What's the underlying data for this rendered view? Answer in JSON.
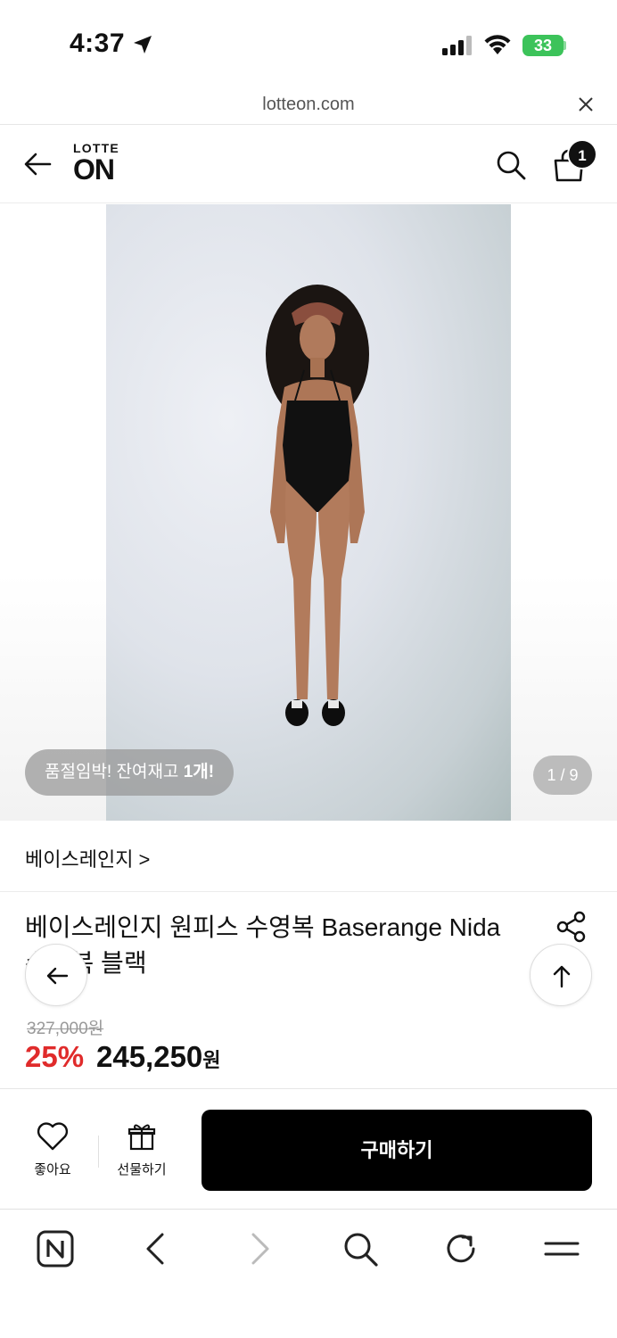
{
  "status_bar": {
    "time": "4:37",
    "battery": "33"
  },
  "url_bar": {
    "url": "lotteon.com"
  },
  "header": {
    "logo_top": "LOTTE",
    "logo_bottom": "ON",
    "cart_count": "1"
  },
  "gallery": {
    "stock_notice_prefix": "품절임박! 잔여재고 ",
    "stock_notice_count": "1개!",
    "page_indicator": "1 / 9"
  },
  "product": {
    "brand_link": "베이스레인지 >",
    "title": "베이스레인지 원피스 수영복 Baserange Nida 수영복 블랙",
    "original_price": "327,000원",
    "discount": "25%",
    "sale_price": "245,250",
    "sale_unit": "원"
  },
  "buy_bar": {
    "like_label": "좋아요",
    "gift_label": "선물하기",
    "purchase_label": "구매하기"
  },
  "icons": {
    "toolbar": [
      "naver-icon",
      "browser-back-icon",
      "browser-forward-icon",
      "search-icon",
      "reload-icon",
      "menu-icon"
    ]
  },
  "colors": {
    "discount": "#e02b2b",
    "purchase_button": "#000000",
    "battery": "#3cc35a"
  }
}
